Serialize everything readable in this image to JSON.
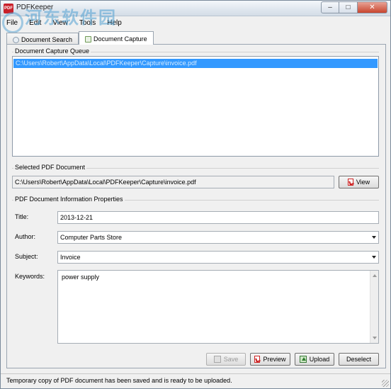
{
  "window": {
    "title": "PDFKeeper",
    "app_icon_text": "PDF"
  },
  "watermark": {
    "text": "河东软件园",
    "url": "www.pc0359.cn"
  },
  "menu": [
    "File",
    "Edit",
    "View",
    "Tools",
    "Help"
  ],
  "tabs": [
    {
      "label": "Document Search",
      "active": false
    },
    {
      "label": "Document Capture",
      "active": true
    }
  ],
  "queue": {
    "label": "Document Capture Queue",
    "items": [
      "C:\\Users\\Robert\\AppData\\Local\\PDFKeeper\\Capture\\invoice.pdf"
    ]
  },
  "selected": {
    "label": "Selected PDF Document",
    "path": "C:\\Users\\Robert\\AppData\\Local\\PDFKeeper\\Capture\\invoice.pdf",
    "view_label": "View"
  },
  "info": {
    "label": "PDF Document Information Properties",
    "title_label": "Title:",
    "title_value": "2013-12-21",
    "author_label": "Author:",
    "author_value": "Computer Parts Store",
    "subject_label": "Subject:",
    "subject_value": "Invoice",
    "keywords_label": "Keywords:",
    "keywords_value": "power supply"
  },
  "actions": {
    "save": "Save",
    "preview": "Preview",
    "upload": "Upload",
    "deselect": "Deselect"
  },
  "status": {
    "text": "Temporary copy of PDF document has been saved and is ready to be uploaded."
  }
}
